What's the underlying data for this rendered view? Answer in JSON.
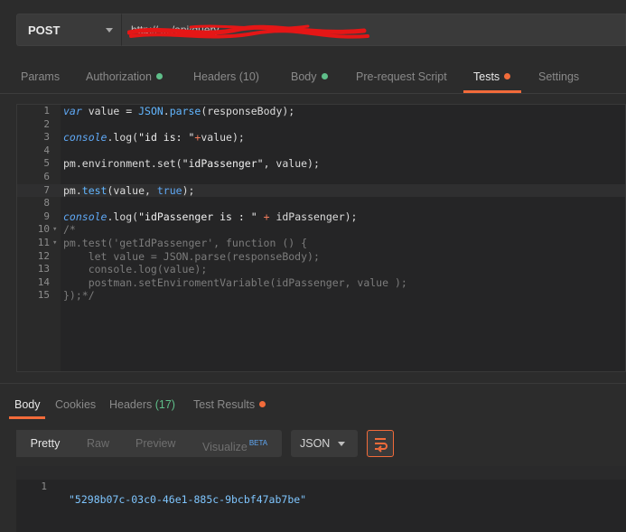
{
  "request": {
    "method": "POST",
    "url": "http:// ... /api/query"
  },
  "request_tabs": [
    {
      "label": "Params",
      "dot": null
    },
    {
      "label": "Authorization",
      "dot": "#5fbf8a"
    },
    {
      "label": "Headers (10)",
      "dot": null
    },
    {
      "label": "Body",
      "dot": "#5fbf8a"
    },
    {
      "label": "Pre-request Script",
      "dot": null
    },
    {
      "label": "Tests",
      "dot": "#f26b3a",
      "active": true
    },
    {
      "label": "Settings",
      "dot": null
    }
  ],
  "editor": {
    "lines": [
      {
        "n": "1",
        "fold": "",
        "html": "<span class=\"kw\">var</span> value = <span class=\"fn\">JSON</span>.<span class=\"fn\">parse</span>(responseBody);"
      },
      {
        "n": "2",
        "fold": "",
        "html": ""
      },
      {
        "n": "3",
        "fold": "",
        "html": "<span class=\"kw\">console</span>.log(<span class=\"str\">\"id is: \"</span><span class=\"op\">+</span>value);"
      },
      {
        "n": "4",
        "fold": "",
        "html": ""
      },
      {
        "n": "5",
        "fold": "",
        "html": "pm.environment.set(<span class=\"str\">\"idPassenger\"</span>, value);"
      },
      {
        "n": "6",
        "fold": "",
        "html": ""
      },
      {
        "n": "7",
        "fold": "",
        "html": "pm.<span class=\"fn\">test</span>(value, <span class=\"bool\">true</span>);",
        "highlight": true
      },
      {
        "n": "8",
        "fold": "",
        "html": ""
      },
      {
        "n": "9",
        "fold": "",
        "html": "<span class=\"kw\">console</span>.log(<span class=\"str\">\"idPassenger is : \"</span> <span class=\"op\">+</span> idPassenger);"
      },
      {
        "n": "10",
        "fold": "▾",
        "html": "<span class=\"cm\">/*</span>"
      },
      {
        "n": "11",
        "fold": "▾",
        "html": "<span class=\"cm\">pm.test('getIdPassenger', function () {</span>"
      },
      {
        "n": "12",
        "fold": "",
        "html": "<span class=\"cm\">    let value = JSON.parse(responseBody);</span>"
      },
      {
        "n": "13",
        "fold": "",
        "html": "<span class=\"cm\">    console.log(value);</span>"
      },
      {
        "n": "14",
        "fold": "",
        "html": "<span class=\"cm\">    postman.setEnviromentVariable(idPassenger, value );</span>"
      },
      {
        "n": "15",
        "fold": "",
        "html": "<span class=\"cm\">});*/</span>"
      }
    ]
  },
  "response_tabs": [
    {
      "label": "Body",
      "active": true
    },
    {
      "label": "Cookies"
    },
    {
      "label": "Headers",
      "count": "(17)"
    },
    {
      "label": "Test Results",
      "dot": "#f26b3a"
    }
  ],
  "format": {
    "buttons": [
      "Pretty",
      "Raw",
      "Preview",
      "Visualize"
    ],
    "beta": "BETA",
    "language": "JSON"
  },
  "response": {
    "line_no": "1",
    "value": "\"5298b07c-03c0-46e1-885c-9bcbf47ab7be\""
  },
  "colors": {
    "accent": "#f26b3a",
    "success": "#5fbf8a",
    "background": "#2c2c2c"
  }
}
